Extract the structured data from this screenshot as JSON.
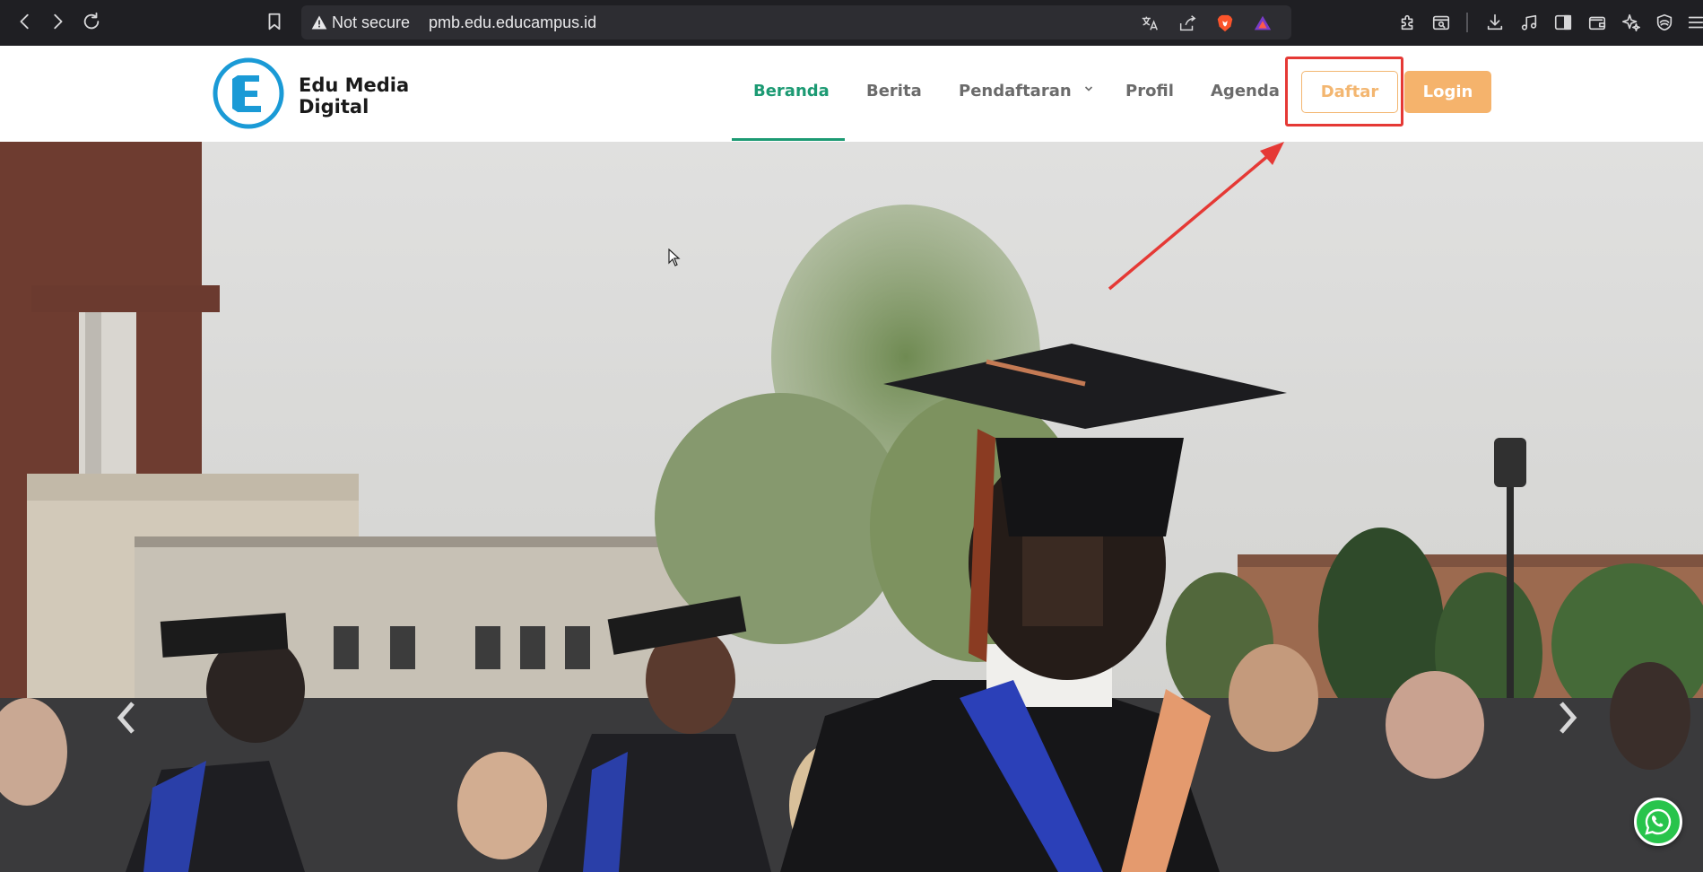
{
  "browser": {
    "security_label": "Not secure",
    "url": "pmb.edu.educampus.id"
  },
  "site": {
    "logo_line1": "Edu Media",
    "logo_line2": "Digital",
    "nav": [
      {
        "label": "Beranda",
        "active": true
      },
      {
        "label": "Berita",
        "active": false
      },
      {
        "label": "Pendaftaran",
        "active": false,
        "dropdown": true
      },
      {
        "label": "Profil",
        "active": false
      },
      {
        "label": "Agenda",
        "active": false
      }
    ],
    "daftar_label": "Daftar",
    "login_label": "Login"
  },
  "colors": {
    "accent_green": "#1c9a73",
    "accent_orange": "#f5b36c",
    "annotation_red": "#e53935",
    "whatsapp_green": "#28c44c"
  },
  "icons": [
    "back-icon",
    "forward-icon",
    "reload-icon",
    "bookmark-icon",
    "warning-icon",
    "translate-icon",
    "share-icon",
    "brave-icon",
    "rewards-icon",
    "extensions-icon",
    "tab-search-icon",
    "download-icon",
    "media-icon",
    "sidebar-icon",
    "wallet-icon",
    "leo-icon",
    "shield-icon",
    "menu-icon",
    "whatsapp-icon"
  ]
}
